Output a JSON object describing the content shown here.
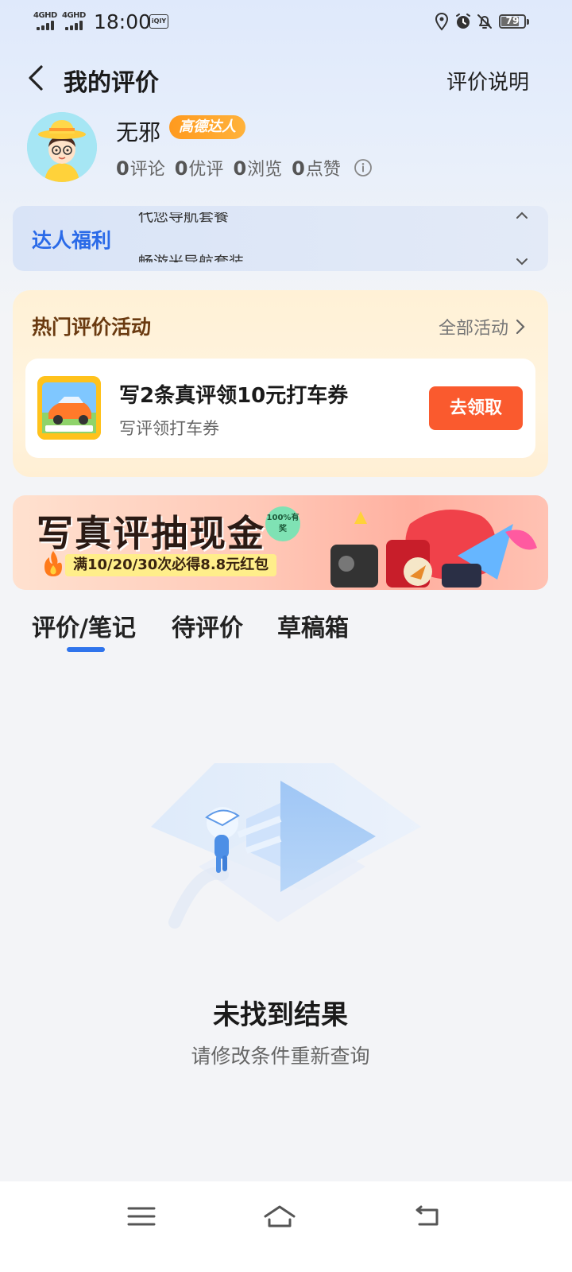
{
  "status_bar": {
    "signal1_label": "4GHD",
    "signal2_label": "4GHD",
    "time": "18:00",
    "app_icon_text": "iQIY",
    "battery_level": 79,
    "battery_text": "79",
    "icons": [
      "location-icon",
      "alarm-icon",
      "bell-off-icon"
    ]
  },
  "header": {
    "title": "我的评价",
    "right_link": "评价说明"
  },
  "profile": {
    "name": "无邪",
    "badge": "高德达人",
    "stats": [
      {
        "count": "0",
        "label": "评论"
      },
      {
        "count": "0",
        "label": "优评"
      },
      {
        "count": "0",
        "label": "浏览"
      },
      {
        "count": "0",
        "label": "点赞"
      }
    ]
  },
  "perks": {
    "title": "达人福利",
    "line1": "代您导航套餐",
    "line2": "畅游米导航套装"
  },
  "activities": {
    "title": "热门评价活动",
    "all_label": "全部活动",
    "item": {
      "name": "写2条真评领10元打车券",
      "sub": "写评领打车券",
      "button": "去领取"
    }
  },
  "banner": {
    "title": "写真评抽现金",
    "pill": "100%有奖",
    "subtitle": "满10/20/30次必得8.8元红包"
  },
  "tabs": [
    {
      "label": "评价/笔记",
      "active": true
    },
    {
      "label": "待评价",
      "active": false
    },
    {
      "label": "草稿箱",
      "active": false
    }
  ],
  "empty_state": {
    "title": "未找到结果",
    "subtitle": "请修改条件重新查询"
  },
  "colors": {
    "accent_blue": "#2f74ec",
    "claim_orange": "#fa5a2e",
    "badge_orange": "#ff9a1e",
    "activity_title_brown": "#6a3a10"
  }
}
